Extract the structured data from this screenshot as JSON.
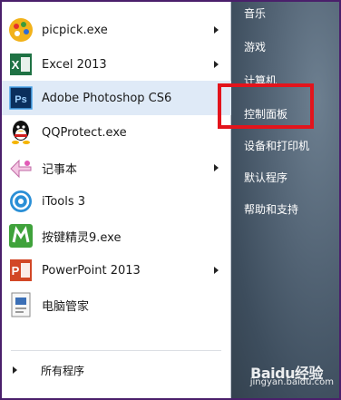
{
  "programs": [
    {
      "label": "picpick.exe",
      "icon": "picpick-icon",
      "arrow": true
    },
    {
      "label": "Excel 2013",
      "icon": "excel-icon",
      "arrow": true
    },
    {
      "label": "Adobe Photoshop CS6",
      "icon": "photoshop-icon",
      "arrow": false
    },
    {
      "label": "QQProtect.exe",
      "icon": "qq-icon",
      "arrow": false
    },
    {
      "label": "记事本",
      "icon": "notepad-icon",
      "arrow": true
    },
    {
      "label": "iTools 3",
      "icon": "itools-icon",
      "arrow": false
    },
    {
      "label": "按键精灵9.exe",
      "icon": "anjian-icon",
      "arrow": false
    },
    {
      "label": "PowerPoint 2013",
      "icon": "powerpoint-icon",
      "arrow": true
    },
    {
      "label": "电脑管家",
      "icon": "pc-manager-icon",
      "arrow": false
    }
  ],
  "all_programs": "所有程序",
  "right_items": [
    "音乐",
    "游戏",
    "计算机",
    "控制面板",
    "设备和打印机",
    "默认程序",
    "帮助和支持"
  ],
  "highlight_item": "控制面板",
  "watermark": {
    "brand": "Baidu经验",
    "url": "jingyan.baidu.com"
  },
  "icon_glyphs": {
    "excel": "X",
    "photoshop": "Ps",
    "powerpoint": "P"
  },
  "colors": {
    "highlight": "#e3141c",
    "hover": "#dfeaf7",
    "excel": "#1f7244",
    "photoshop": "#0b2f5c",
    "powerpoint": "#d24726"
  }
}
